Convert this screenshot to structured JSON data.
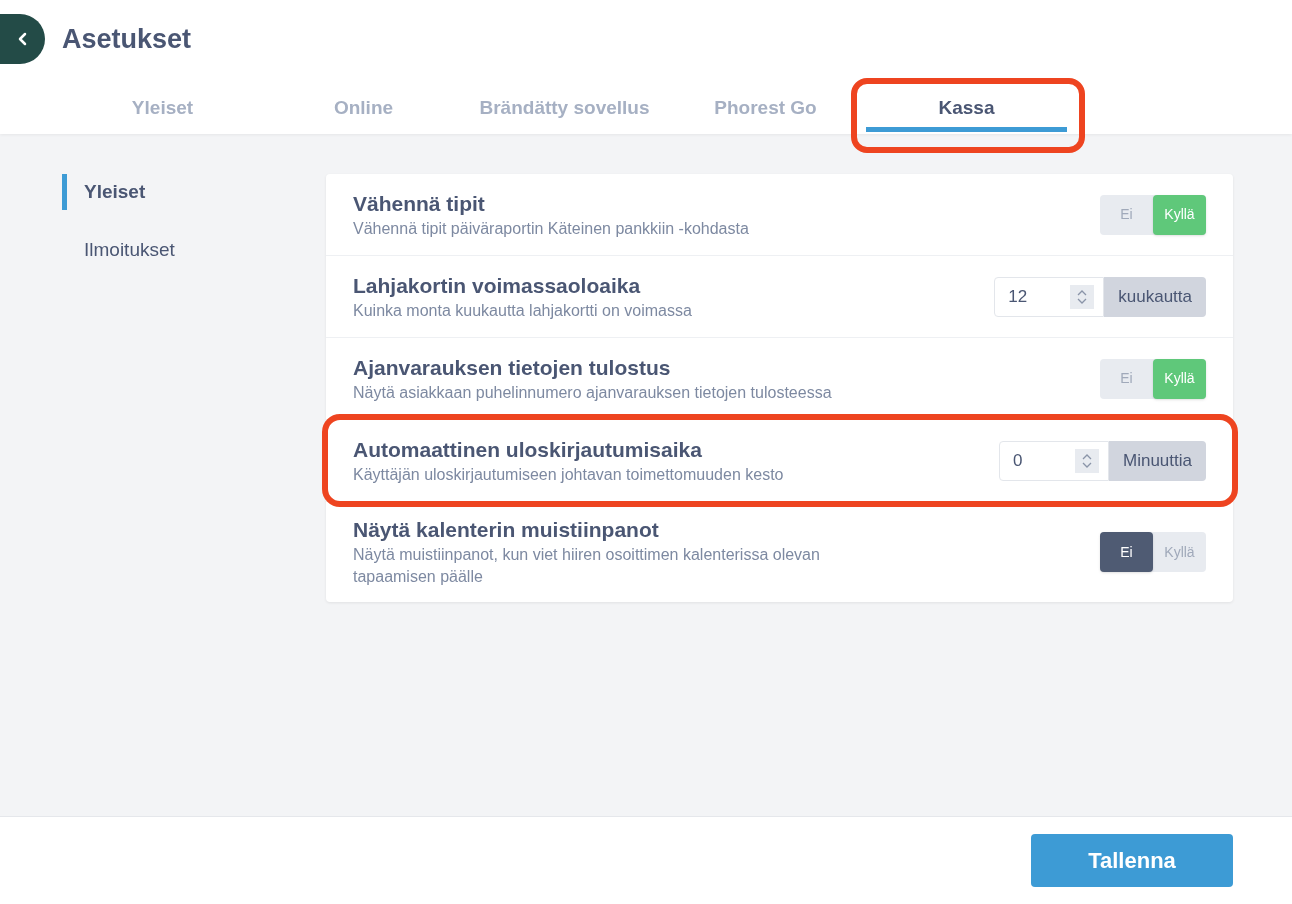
{
  "header": {
    "title": "Asetukset"
  },
  "tabs": [
    {
      "label": "Yleiset",
      "selected": false,
      "highlighted": false
    },
    {
      "label": "Online",
      "selected": false,
      "highlighted": false
    },
    {
      "label": "Brändätty sovellus",
      "selected": false,
      "highlighted": false
    },
    {
      "label": "Phorest Go",
      "selected": false,
      "highlighted": false
    },
    {
      "label": "Kassa",
      "selected": true,
      "highlighted": true
    }
  ],
  "sidebar": {
    "items": [
      {
        "label": "Yleiset",
        "selected": true
      },
      {
        "label": "Ilmoitukset",
        "selected": false
      }
    ]
  },
  "settings": [
    {
      "kind": "toggle",
      "title": "Vähennä tipit",
      "description": "Vähennä tipit päiväraportin Käteinen pankkiin -kohdasta",
      "highlighted": false,
      "options": [
        {
          "label": "Ei",
          "selected": false
        },
        {
          "label": "Kyllä",
          "selected": true
        }
      ]
    },
    {
      "kind": "number",
      "title": "Lahjakortin voimassaoloaika",
      "description": "Kuinka monta kuukautta lahjakortti on voimassa",
      "highlighted": false,
      "value": "12",
      "unit": "kuukautta"
    },
    {
      "kind": "toggle",
      "title": "Ajanvarauksen tietojen tulostus",
      "description": "Näytä asiakkaan puhelinnumero ajanvarauksen tietojen tulosteessa",
      "highlighted": false,
      "options": [
        {
          "label": "Ei",
          "selected": false
        },
        {
          "label": "Kyllä",
          "selected": true
        }
      ]
    },
    {
      "kind": "number",
      "title": "Automaattinen uloskirjautumisaika",
      "description": "Käyttäjän uloskirjautumiseen johtavan toimettomuuden kesto",
      "highlighted": true,
      "value": "0",
      "unit": "Minuuttia"
    },
    {
      "kind": "toggle",
      "title": "Näytä kalenterin muistiinpanot",
      "description": "Näytä muistiinpanot, kun viet hiiren osoittimen kalenterissa olevan tapaamisen päälle",
      "highlighted": false,
      "options": [
        {
          "label": "Ei",
          "selected": true
        },
        {
          "label": "Kyllä",
          "selected": false
        }
      ]
    }
  ],
  "footer": {
    "save_button": "Tallenna"
  }
}
